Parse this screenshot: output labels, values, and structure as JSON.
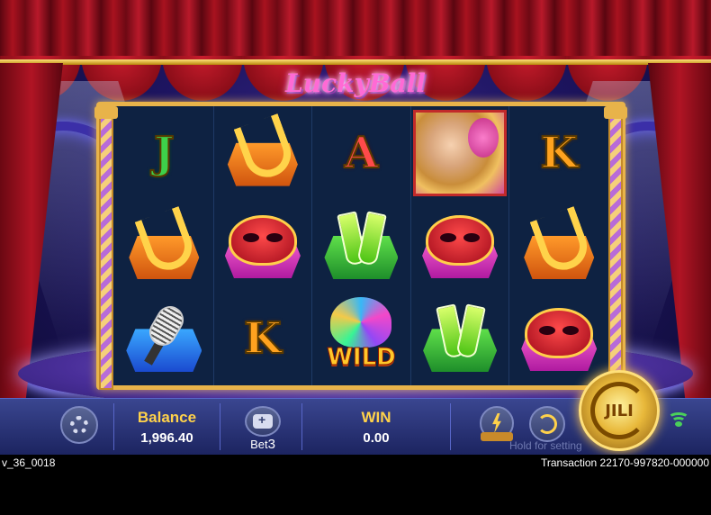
{
  "game": {
    "logo_text": "LuckyBall"
  },
  "reels": [
    [
      {
        "symbol": "J",
        "kind": "letter",
        "color": "green"
      },
      {
        "symbol": "saxophone",
        "kind": "sax"
      },
      {
        "symbol": "A",
        "kind": "letter",
        "color": "red"
      },
      {
        "symbol": "lady-portrait",
        "kind": "lady"
      },
      {
        "symbol": "K",
        "kind": "letter",
        "color": "orange"
      }
    ],
    [
      {
        "symbol": "saxophone",
        "kind": "sax"
      },
      {
        "symbol": "mask",
        "kind": "mask"
      },
      {
        "symbol": "champagne-glasses",
        "kind": "glass"
      },
      {
        "symbol": "mask",
        "kind": "mask"
      },
      {
        "symbol": "saxophone",
        "kind": "sax"
      }
    ],
    [
      {
        "symbol": "microphone",
        "kind": "mic"
      },
      {
        "symbol": "K",
        "kind": "letter",
        "color": "orange"
      },
      {
        "symbol": "WILD",
        "kind": "wild"
      },
      {
        "symbol": "champagne-glasses",
        "kind": "glass"
      },
      {
        "symbol": "mask",
        "kind": "mask"
      }
    ]
  ],
  "controls": {
    "settings_icon": "gear-icon",
    "balance_label": "Balance",
    "balance_value": "1,996.40",
    "bet_label": "Bet",
    "bet_value": "3",
    "win_label": "WIN",
    "win_value": "0.00",
    "turbo_icon": "lightning-icon",
    "autoplay_icon": "autoplay-icon",
    "hold_hint": "Hold for setting",
    "spin_label": "JILI",
    "signal_icon": "wifi-icon"
  },
  "status": {
    "version": "v_36_0018",
    "transaction": "Transaction 22170-997820-000000"
  },
  "colors": {
    "accent_gold": "#ffd24a",
    "bar_bg": "#2a3478",
    "frame_gold": "#e8b34a"
  }
}
